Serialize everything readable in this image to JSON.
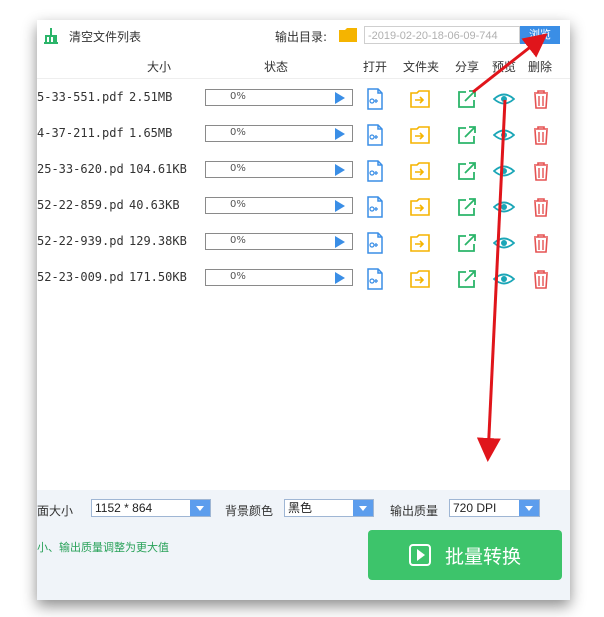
{
  "toolbar": {
    "clear_label": "清空文件列表",
    "output_dir_label": "输出目录:",
    "output_path": "-2019-02-20-18-06-09-744",
    "browse_label": "浏览"
  },
  "table": {
    "headers": {
      "size": "大小",
      "status": "状态",
      "open": "打开",
      "folder": "文件夹",
      "share": "分享",
      "preview": "预览",
      "delete": "删除"
    },
    "rows": [
      {
        "name": "5-33-551.pdf",
        "size": "2.51MB",
        "progress": "0%"
      },
      {
        "name": "4-37-211.pdf",
        "size": "1.65MB",
        "progress": "0%"
      },
      {
        "name": "25-33-620.pd",
        "size": "104.61KB",
        "progress": "0%"
      },
      {
        "name": "52-22-859.pd",
        "size": "40.63KB",
        "progress": "0%"
      },
      {
        "name": "52-22-939.pd",
        "size": "129.38KB",
        "progress": "0%"
      },
      {
        "name": "52-23-009.pd",
        "size": "171.50KB",
        "progress": "0%"
      }
    ]
  },
  "settings": {
    "page_size_label": "面大小",
    "page_size_value": "1152 * 864",
    "bg_color_label": "背景颜色",
    "bg_color_value": "黑色",
    "quality_label": "输出质量",
    "quality_value": "720 DPI"
  },
  "footer": {
    "hint": "小、输出质量调整为更大值",
    "batch_label": "批量转换"
  },
  "colors": {
    "accent": "#3a8ee6",
    "green": "#3dc46b",
    "folder": "#f5b400",
    "share": "#2bb56a",
    "preview": "#1aa6b7",
    "delete": "#e55353",
    "arrow": "#e0151b"
  }
}
